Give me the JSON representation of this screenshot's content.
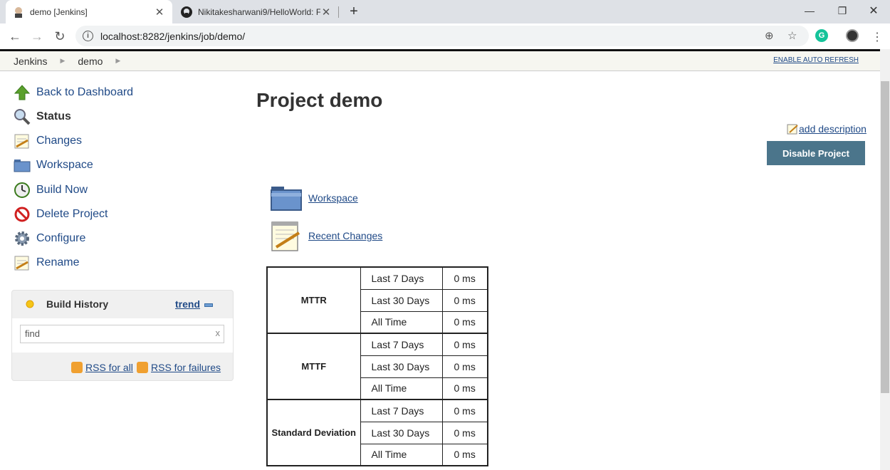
{
  "browser": {
    "tabs": [
      {
        "title": "demo [Jenkins]",
        "close": "✕"
      },
      {
        "title": "Nikitakesharwani9/HelloWorld: F",
        "close": "✕"
      }
    ],
    "new_tab": "+",
    "url": "localhost:8282/jenkins/job/demo/",
    "window_controls": {
      "minimize": "—",
      "restore": "❐",
      "close": "✕"
    },
    "nav": {
      "back": "←",
      "forward": "→",
      "reload": "↻"
    },
    "omnibox_icons": {
      "zoom": "⊕",
      "bookmark": "☆"
    },
    "extension_letter": "G"
  },
  "breadcrumb": {
    "items": [
      "Jenkins",
      "demo"
    ],
    "auto_refresh": "ENABLE AUTO REFRESH"
  },
  "sidebar": {
    "items": [
      {
        "label": "Back to Dashboard",
        "icon": "up-arrow-icon"
      },
      {
        "label": "Status",
        "icon": "magnifier-icon"
      },
      {
        "label": "Changes",
        "icon": "notepad-icon"
      },
      {
        "label": "Workspace",
        "icon": "folder-icon"
      },
      {
        "label": "Build Now",
        "icon": "clock-icon"
      },
      {
        "label": "Delete Project",
        "icon": "no-entry-icon"
      },
      {
        "label": "Configure",
        "icon": "gear-icon"
      },
      {
        "label": "Rename",
        "icon": "notepad-icon"
      }
    ]
  },
  "build_history": {
    "title": "Build History",
    "trend": "trend",
    "search_placeholder": "find",
    "clear": "x",
    "rss_all": "RSS for all",
    "rss_failures": "RSS for failures"
  },
  "main": {
    "title": "Project demo",
    "add_description": "add description",
    "disable_button": "Disable Project",
    "links": [
      {
        "label": "Workspace",
        "icon": "folder-icon"
      },
      {
        "label": "Recent Changes",
        "icon": "notepad-icon"
      }
    ]
  },
  "stats": {
    "groups": [
      {
        "name": "MTTR",
        "rows": [
          [
            "Last 7 Days",
            "0 ms"
          ],
          [
            "Last 30 Days",
            "0 ms"
          ],
          [
            "All Time",
            "0 ms"
          ]
        ]
      },
      {
        "name": "MTTF",
        "rows": [
          [
            "Last 7 Days",
            "0 ms"
          ],
          [
            "Last 30 Days",
            "0 ms"
          ],
          [
            "All Time",
            "0 ms"
          ]
        ]
      },
      {
        "name": "Standard Deviation",
        "rows": [
          [
            "Last 7 Days",
            "0 ms"
          ],
          [
            "Last 30 Days",
            "0 ms"
          ],
          [
            "All Time",
            "0 ms"
          ]
        ]
      }
    ]
  }
}
